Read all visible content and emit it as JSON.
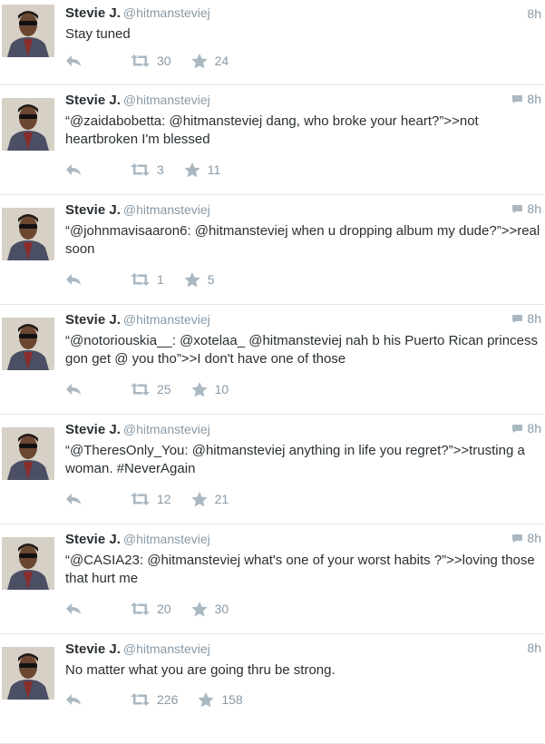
{
  "tweets": [
    {
      "name": "Stevie J.",
      "handle": "@hitmansteviej",
      "time": "8h",
      "conversation": false,
      "text": "Stay tuned",
      "retweets": "30",
      "favorites": "24"
    },
    {
      "name": "Stevie J.",
      "handle": "@hitmansteviej",
      "time": "8h",
      "conversation": true,
      "text": "“@zaidabobetta: @hitmansteviej dang, who broke your heart?”>>not heartbroken I'm blessed",
      "retweets": "3",
      "favorites": "11"
    },
    {
      "name": "Stevie J.",
      "handle": "@hitmansteviej",
      "time": "8h",
      "conversation": true,
      "text": "“@johnmavisaaron6: @hitmansteviej when u dropping album my dude?”>>real soon",
      "retweets": "1",
      "favorites": "5"
    },
    {
      "name": "Stevie J.",
      "handle": "@hitmansteviej",
      "time": "8h",
      "conversation": true,
      "text": "“@notoriouskia__: @xotelaa_ @hitmansteviej nah b his Puerto Rican princess gon get @ you tho”>>I don't have one of those",
      "retweets": "25",
      "favorites": "10"
    },
    {
      "name": "Stevie J.",
      "handle": "@hitmansteviej",
      "time": "8h",
      "conversation": true,
      "text": "“@TheresOnly_You: @hitmansteviej anything in life you regret?”>>trusting a woman. #NeverAgain",
      "retweets": "12",
      "favorites": "21"
    },
    {
      "name": "Stevie J.",
      "handle": "@hitmansteviej",
      "time": "8h",
      "conversation": true,
      "text": "“@CASIA23: @hitmansteviej what's one of your worst habits ?”>>loving those that hurt me",
      "retweets": "20",
      "favorites": "30"
    },
    {
      "name": "Stevie J.",
      "handle": "@hitmansteviej",
      "time": "8h",
      "conversation": false,
      "text": "No matter what you are going thru be strong.",
      "retweets": "226",
      "favorites": "158"
    }
  ],
  "icons": {
    "reply": "reply-icon",
    "retweet": "retweet-icon",
    "favorite": "star-icon",
    "conversation": "conversation-bubble-icon"
  },
  "colors": {
    "name": "#292f33",
    "meta": "#8899a6",
    "divider": "#e1e8ed",
    "icon": "#aab8c2"
  }
}
